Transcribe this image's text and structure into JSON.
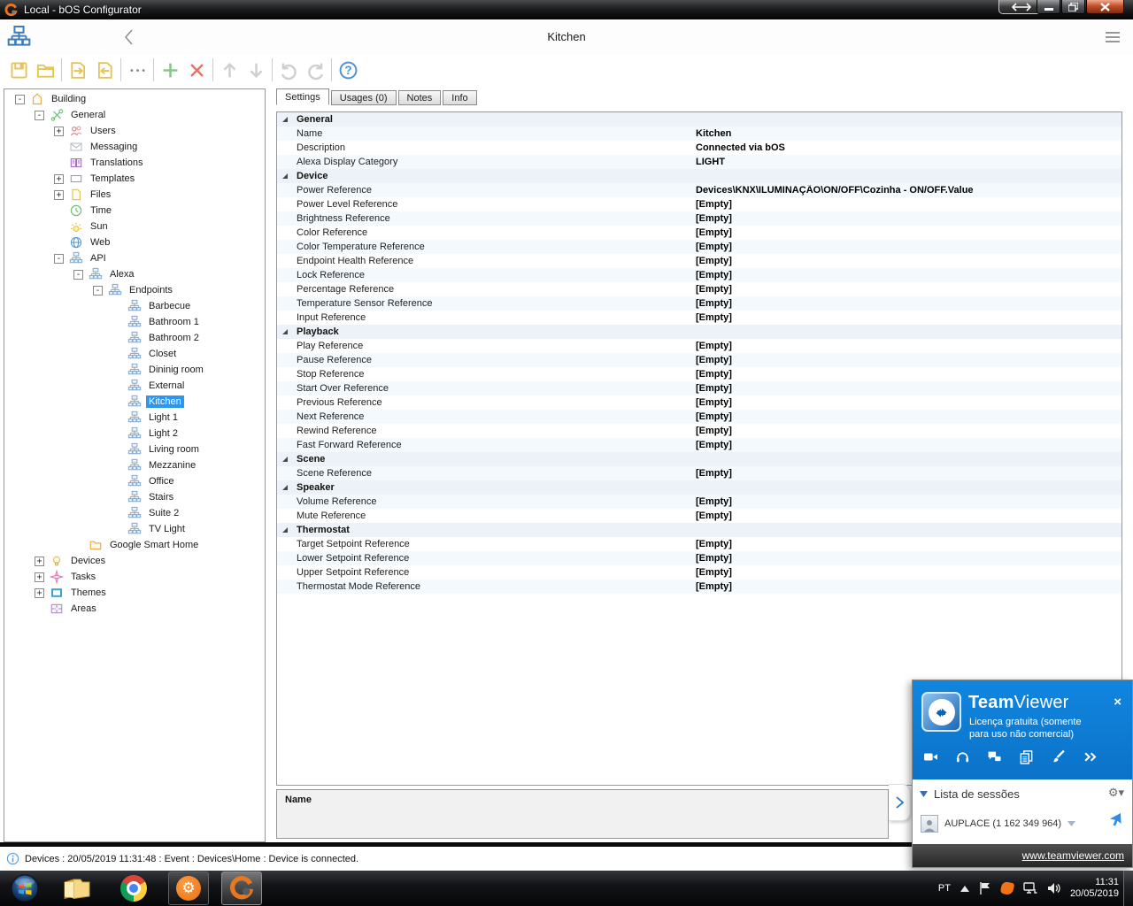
{
  "colors": {
    "selection": "#2e96ef",
    "teamviewer_blue": "#0d7cd6",
    "icon_yellow": "#e4c455",
    "close_red": "#c2502b"
  },
  "title_bar": {
    "title": "Local - bOS Configurator",
    "controls": {
      "minimize": "minimize",
      "restore": "restore",
      "close": "close",
      "session_arrows": "left-right"
    }
  },
  "app_header": {
    "title": "Kitchen"
  },
  "toolbar": {
    "buttons": [
      {
        "name": "save",
        "icon": "floppy"
      },
      {
        "name": "open",
        "icon": "folder-open"
      },
      {
        "name": "export",
        "icon": "file-export"
      },
      {
        "name": "import",
        "icon": "file-import"
      },
      {
        "name": "more",
        "icon": "ellipsis"
      },
      {
        "name": "add",
        "icon": "plus-green"
      },
      {
        "name": "delete",
        "icon": "cross-red"
      },
      {
        "name": "move-up",
        "icon": "arrow-up"
      },
      {
        "name": "move-down",
        "icon": "arrow-down"
      },
      {
        "name": "undo",
        "icon": "undo"
      },
      {
        "name": "redo",
        "icon": "redo"
      },
      {
        "name": "help",
        "icon": "help"
      }
    ]
  },
  "tree": {
    "items": [
      {
        "label": "Building",
        "level": 0,
        "icon": "house",
        "expander": "minus"
      },
      {
        "label": "General",
        "level": 1,
        "icon": "tools",
        "expander": "minus"
      },
      {
        "label": "Users",
        "level": 2,
        "icon": "users",
        "expander": "plus"
      },
      {
        "label": "Messaging",
        "level": 2,
        "icon": "envelope",
        "expander": null
      },
      {
        "label": "Translations",
        "level": 2,
        "icon": "book",
        "expander": null
      },
      {
        "label": "Templates",
        "level": 2,
        "icon": "template",
        "expander": "plus"
      },
      {
        "label": "Files",
        "level": 2,
        "icon": "file",
        "expander": "plus"
      },
      {
        "label": "Time",
        "level": 2,
        "icon": "clock",
        "expander": null
      },
      {
        "label": "Sun",
        "level": 2,
        "icon": "sun",
        "expander": null
      },
      {
        "label": "Web",
        "level": 2,
        "icon": "globe",
        "expander": null
      },
      {
        "label": "API",
        "level": 2,
        "icon": "sitemap",
        "expander": "minus"
      },
      {
        "label": "Alexa",
        "level": 3,
        "icon": "sitemap",
        "expander": "minus"
      },
      {
        "label": "Endpoints",
        "level": 4,
        "icon": "sitemap",
        "expander": "minus"
      },
      {
        "label": "Barbecue",
        "level": 5,
        "icon": "sitemap",
        "expander": null
      },
      {
        "label": "Bathroom 1",
        "level": 5,
        "icon": "sitemap",
        "expander": null
      },
      {
        "label": "Bathroom 2",
        "level": 5,
        "icon": "sitemap",
        "expander": null
      },
      {
        "label": "Closet",
        "level": 5,
        "icon": "sitemap",
        "expander": null
      },
      {
        "label": "Dininig room",
        "level": 5,
        "icon": "sitemap",
        "expander": null
      },
      {
        "label": "External",
        "level": 5,
        "icon": "sitemap",
        "expander": null
      },
      {
        "label": "Kitchen",
        "level": 5,
        "icon": "sitemap",
        "expander": null,
        "selected": true
      },
      {
        "label": "Light 1",
        "level": 5,
        "icon": "sitemap",
        "expander": null
      },
      {
        "label": "Light 2",
        "level": 5,
        "icon": "sitemap",
        "expander": null
      },
      {
        "label": "Living room",
        "level": 5,
        "icon": "sitemap",
        "expander": null
      },
      {
        "label": "Mezzanine",
        "level": 5,
        "icon": "sitemap",
        "expander": null
      },
      {
        "label": "Office",
        "level": 5,
        "icon": "sitemap",
        "expander": null
      },
      {
        "label": "Stairs",
        "level": 5,
        "icon": "sitemap",
        "expander": null
      },
      {
        "label": "Suite 2",
        "level": 5,
        "icon": "sitemap",
        "expander": null
      },
      {
        "label": "TV Light",
        "level": 5,
        "icon": "sitemap",
        "expander": null
      },
      {
        "label": "Google Smart Home",
        "level": 3,
        "icon": "folder",
        "expander": null
      },
      {
        "label": "Devices",
        "level": 1,
        "icon": "bulb",
        "expander": "plus"
      },
      {
        "label": "Tasks",
        "level": 1,
        "icon": "tasks",
        "expander": "plus"
      },
      {
        "label": "Themes",
        "level": 1,
        "icon": "themes",
        "expander": "plus"
      },
      {
        "label": "Areas",
        "level": 1,
        "icon": "areas",
        "expander": null
      }
    ]
  },
  "tabs": [
    {
      "label": "Settings",
      "active": true
    },
    {
      "label": "Usages (0)",
      "active": false
    },
    {
      "label": "Notes",
      "active": false
    },
    {
      "label": "Info",
      "active": false
    }
  ],
  "settings": {
    "sections": [
      {
        "title": "General",
        "rows": [
          {
            "label": "Name",
            "value": "Kitchen"
          },
          {
            "label": "Description",
            "value": "Connected via bOS"
          },
          {
            "label": "Alexa Display Category",
            "value": "LIGHT"
          }
        ]
      },
      {
        "title": "Device",
        "rows": [
          {
            "label": "Power Reference",
            "value": "Devices\\KNX\\ILUMINAÇÃO\\ON/OFF\\Cozinha - ON/OFF.Value"
          },
          {
            "label": "Power Level Reference",
            "value": "[Empty]"
          },
          {
            "label": "Brightness Reference",
            "value": "[Empty]"
          },
          {
            "label": "Color Reference",
            "value": "[Empty]"
          },
          {
            "label": "Color Temperature Reference",
            "value": "[Empty]"
          },
          {
            "label": "Endpoint Health Reference",
            "value": "[Empty]"
          },
          {
            "label": "Lock Reference",
            "value": "[Empty]"
          },
          {
            "label": "Percentage Reference",
            "value": "[Empty]"
          },
          {
            "label": "Temperature Sensor Reference",
            "value": "[Empty]"
          },
          {
            "label": "Input Reference",
            "value": "[Empty]"
          }
        ]
      },
      {
        "title": "Playback",
        "rows": [
          {
            "label": "Play Reference",
            "value": "[Empty]"
          },
          {
            "label": "Pause Reference",
            "value": "[Empty]"
          },
          {
            "label": "Stop Reference",
            "value": "[Empty]"
          },
          {
            "label": "Start Over Reference",
            "value": "[Empty]"
          },
          {
            "label": "Previous Reference",
            "value": "[Empty]"
          },
          {
            "label": "Next Reference",
            "value": "[Empty]"
          },
          {
            "label": "Rewind Reference",
            "value": "[Empty]"
          },
          {
            "label": "Fast Forward Reference",
            "value": "[Empty]"
          }
        ]
      },
      {
        "title": "Scene",
        "rows": [
          {
            "label": "Scene Reference",
            "value": "[Empty]"
          }
        ]
      },
      {
        "title": "Speaker",
        "rows": [
          {
            "label": "Volume Reference",
            "value": "[Empty]"
          },
          {
            "label": "Mute Reference",
            "value": "[Empty]"
          }
        ]
      },
      {
        "title": "Thermostat",
        "rows": [
          {
            "label": "Target Setpoint Reference",
            "value": "[Empty]"
          },
          {
            "label": "Lower Setpoint Reference",
            "value": "[Empty]"
          },
          {
            "label": "Upper Setpoint Reference",
            "value": "[Empty]"
          },
          {
            "label": "Thermostat Mode Reference",
            "value": "[Empty]"
          }
        ]
      }
    ]
  },
  "bottom_panel": {
    "label": "Name"
  },
  "status_bar": {
    "text": "Devices : 20/05/2019 11:31:48 : Event : Devices\\Home : Device is connected."
  },
  "teamviewer": {
    "brand_bold": "Team",
    "brand_rest": "Viewer",
    "license_line1": "Licença gratuita (somente",
    "license_line2": "para uso não comercial)",
    "close_label": "×",
    "toolbar_icons": [
      "video-camera",
      "headset",
      "chat",
      "copy",
      "brush",
      "chevrons-right"
    ],
    "sessions_title": "Lista de sessões",
    "session_name": "AUPLACE (1 162 349 964)",
    "footer_link": "www.teamviewer.com"
  },
  "taskbar": {
    "apps": [
      "start",
      "explorer",
      "chrome",
      "bos-server",
      "bos-configurator"
    ],
    "language": "PT",
    "time": "11:31",
    "date": "20/05/2019"
  }
}
